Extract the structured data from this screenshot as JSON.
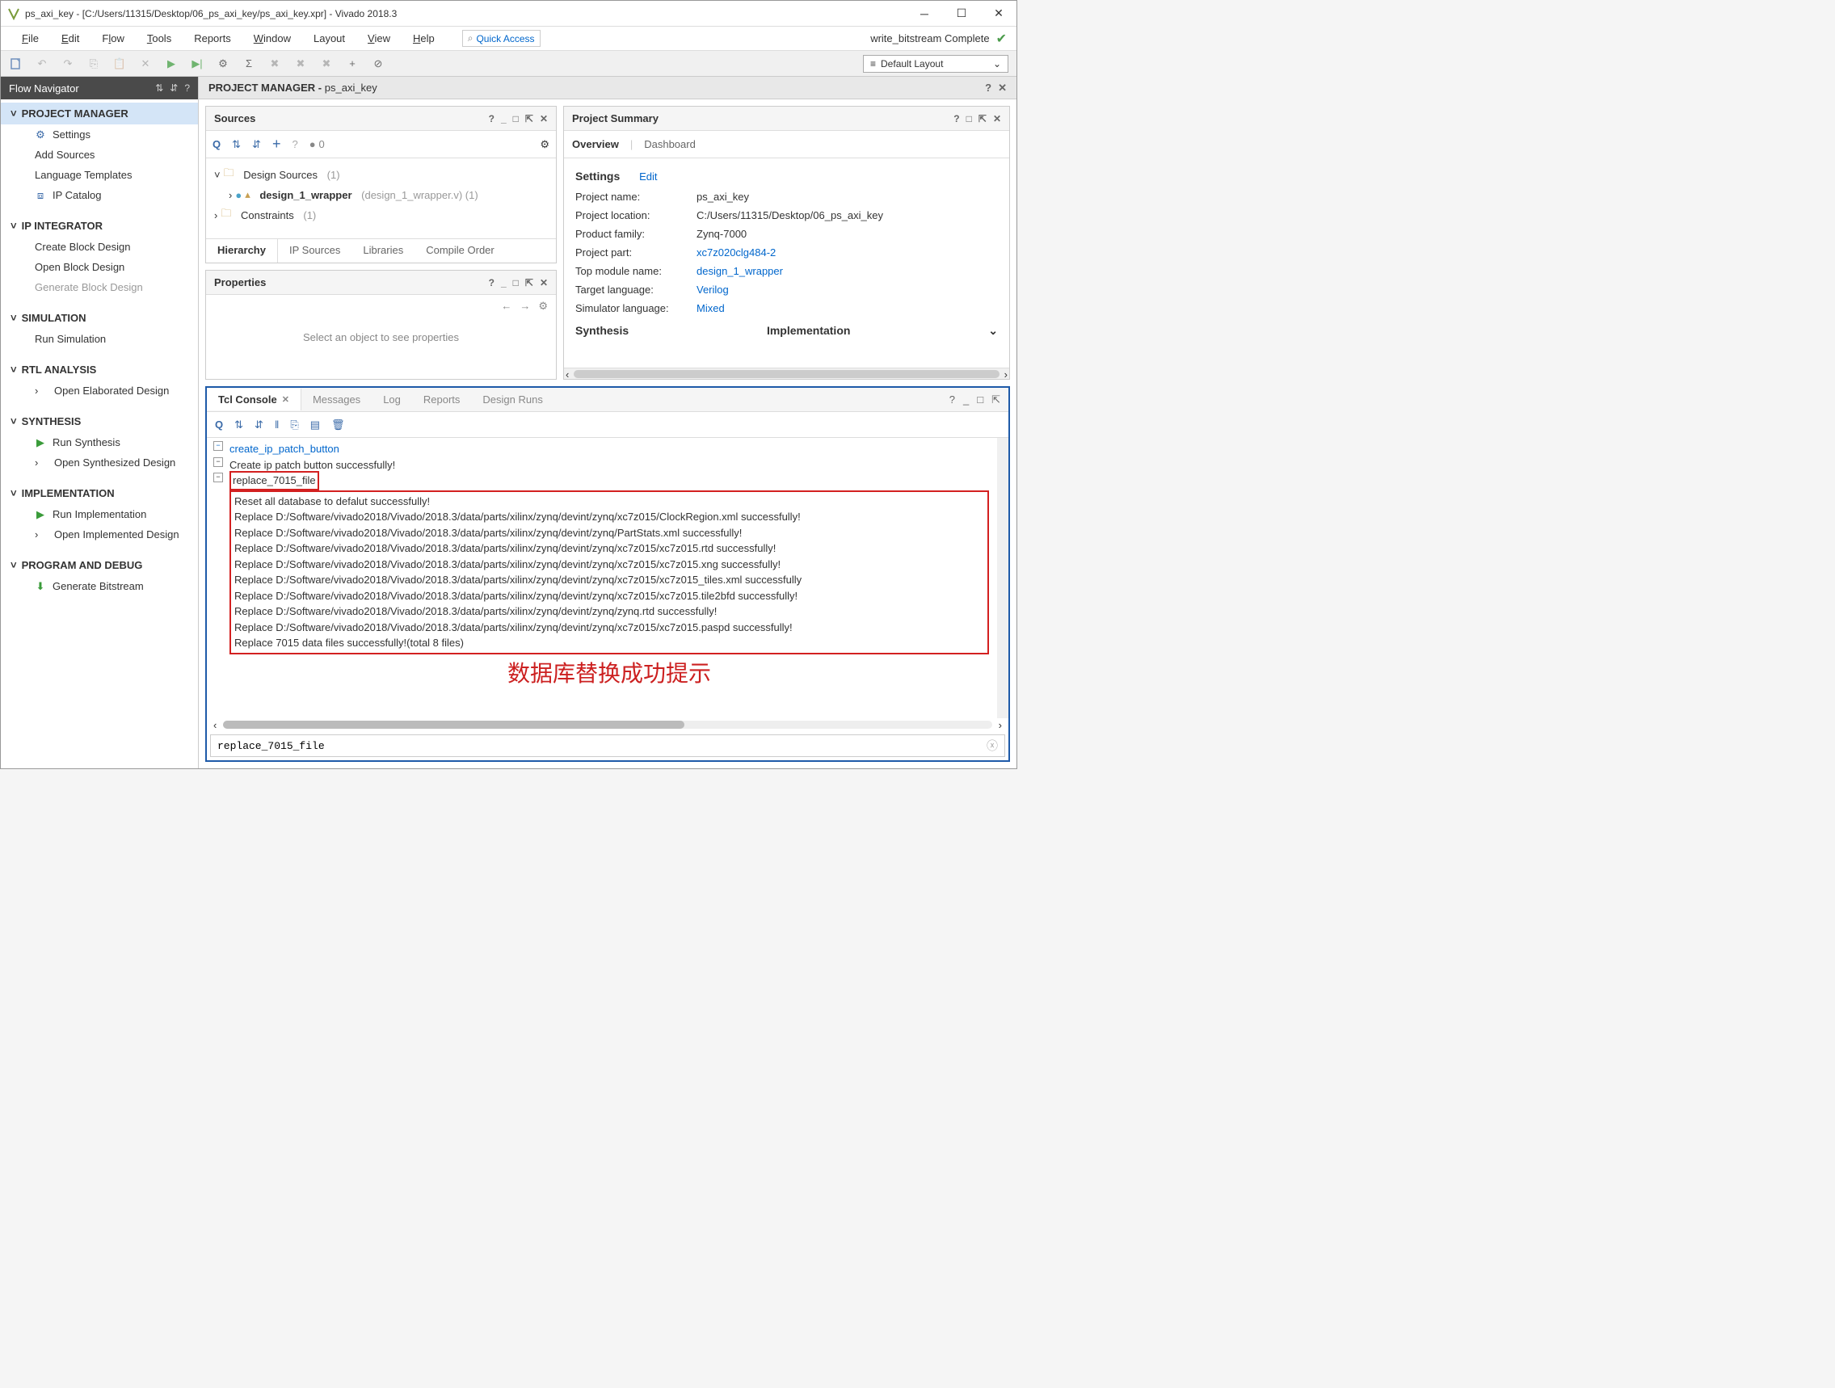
{
  "window": {
    "title": "ps_axi_key - [C:/Users/11315/Desktop/06_ps_axi_key/ps_axi_key.xpr] - Vivado 2018.3"
  },
  "menubar": {
    "file": "File",
    "edit": "Edit",
    "flow": "Flow",
    "tools": "Tools",
    "reports": "Reports",
    "window": "Window",
    "layout": "Layout",
    "view": "View",
    "help": "Help",
    "quick_access": "Quick Access"
  },
  "status": {
    "text": "write_bitstream Complete"
  },
  "layout_combo": {
    "value": "Default Layout"
  },
  "flownav": {
    "title": "Flow Navigator",
    "sections": {
      "project_manager": "PROJECT MANAGER",
      "ip_integrator": "IP INTEGRATOR",
      "simulation": "SIMULATION",
      "rtl_analysis": "RTL ANALYSIS",
      "synthesis": "SYNTHESIS",
      "implementation": "IMPLEMENTATION",
      "program_debug": "PROGRAM AND DEBUG"
    },
    "items": {
      "settings": "Settings",
      "add_sources": "Add Sources",
      "language_templates": "Language Templates",
      "ip_catalog": "IP Catalog",
      "create_block_design": "Create Block Design",
      "open_block_design": "Open Block Design",
      "generate_block_design": "Generate Block Design",
      "run_simulation": "Run Simulation",
      "open_elaborated": "Open Elaborated Design",
      "run_synthesis": "Run Synthesis",
      "open_synthesized": "Open Synthesized Design",
      "run_implementation": "Run Implementation",
      "open_implemented": "Open Implemented Design",
      "generate_bitstream": "Generate Bitstream"
    }
  },
  "pm_header": {
    "prefix": "PROJECT MANAGER",
    "name": "ps_axi_key"
  },
  "sources": {
    "title": "Sources",
    "badge": "0",
    "design_sources": "Design Sources",
    "design_sources_count": "(1)",
    "wrapper": "design_1_wrapper",
    "wrapper_file": "(design_1_wrapper.v) (1)",
    "constraints": "Constraints",
    "constraints_count": "(1)",
    "tabs": {
      "hierarchy": "Hierarchy",
      "ip_sources": "IP Sources",
      "libraries": "Libraries",
      "compile_order": "Compile Order"
    }
  },
  "properties": {
    "title": "Properties",
    "placeholder": "Select an object to see properties"
  },
  "summary": {
    "title": "Project Summary",
    "tabs": {
      "overview": "Overview",
      "dashboard": "Dashboard"
    },
    "settings_title": "Settings",
    "edit": "Edit",
    "rows": {
      "project_name": {
        "label": "Project name:",
        "value": "ps_axi_key"
      },
      "project_location": {
        "label": "Project location:",
        "value": "C:/Users/11315/Desktop/06_ps_axi_key"
      },
      "product_family": {
        "label": "Product family:",
        "value": "Zynq-7000"
      },
      "project_part": {
        "label": "Project part:",
        "value": "xc7z020clg484-2"
      },
      "top_module": {
        "label": "Top module name:",
        "value": "design_1_wrapper"
      },
      "target_lang": {
        "label": "Target language:",
        "value": "Verilog"
      },
      "sim_lang": {
        "label": "Simulator language:",
        "value": "Mixed"
      }
    },
    "synthesis": "Synthesis",
    "implementation": "Implementation"
  },
  "bottom_tabs": {
    "tcl": "Tcl Console",
    "messages": "Messages",
    "log": "Log",
    "reports": "Reports",
    "design_runs": "Design Runs"
  },
  "console": {
    "cmd1": "create_ip_patch_button",
    "line2": "Create ip patch button successfully!",
    "cmd2": "replace_7015_file",
    "lines": [
      "Reset all database to defalut successfully!",
      "Replace D:/Software/vivado2018/Vivado/2018.3/data/parts/xilinx/zynq/devint/zynq/xc7z015/ClockRegion.xml successfully!",
      "Replace D:/Software/vivado2018/Vivado/2018.3/data/parts/xilinx/zynq/devint/zynq/PartStats.xml successfully!",
      "Replace D:/Software/vivado2018/Vivado/2018.3/data/parts/xilinx/zynq/devint/zynq/xc7z015/xc7z015.rtd successfully!",
      "Replace D:/Software/vivado2018/Vivado/2018.3/data/parts/xilinx/zynq/devint/zynq/xc7z015/xc7z015.xng successfully!",
      "Replace D:/Software/vivado2018/Vivado/2018.3/data/parts/xilinx/zynq/devint/zynq/xc7z015/xc7z015_tiles.xml successfully",
      "Replace D:/Software/vivado2018/Vivado/2018.3/data/parts/xilinx/zynq/devint/zynq/xc7z015/xc7z015.tile2bfd successfully!",
      "Replace D:/Software/vivado2018/Vivado/2018.3/data/parts/xilinx/zynq/devint/zynq/zynq.rtd successfully!",
      "Replace D:/Software/vivado2018/Vivado/2018.3/data/parts/xilinx/zynq/devint/zynq/xc7z015/xc7z015.paspd successfully!",
      "Replace 7015 data files successfully!(total 8 files)"
    ],
    "annotation": "数据库替换成功提示",
    "input_value": "replace_7015_file"
  }
}
